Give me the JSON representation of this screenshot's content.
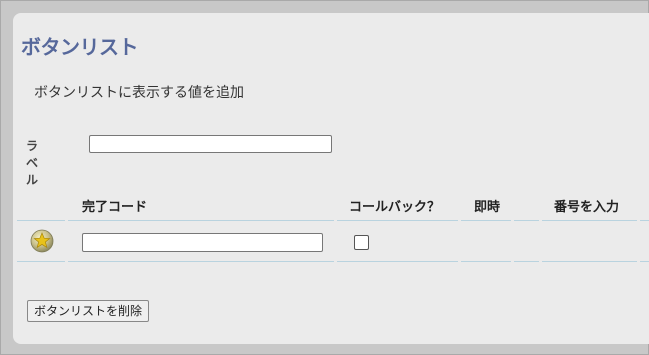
{
  "page": {
    "title": "ボタンリスト",
    "subtitle": "ボタンリストに表示する値を追加"
  },
  "label_field": {
    "label": "ラベル",
    "value": ""
  },
  "table": {
    "columns": [
      "完了コード",
      "コールバック？",
      "即時",
      "番号を入力"
    ],
    "rows": [
      {
        "icon": "star-coin-icon",
        "code_value": "",
        "callback_checked": false
      }
    ]
  },
  "actions": {
    "delete_label": "ボタンリストを削除"
  },
  "colors": {
    "title": "#56689b",
    "panel": "#ebebeb",
    "background": "#c8c8c8",
    "row_divider": "#b9d3df",
    "icon_gold": "#e8c21a"
  }
}
